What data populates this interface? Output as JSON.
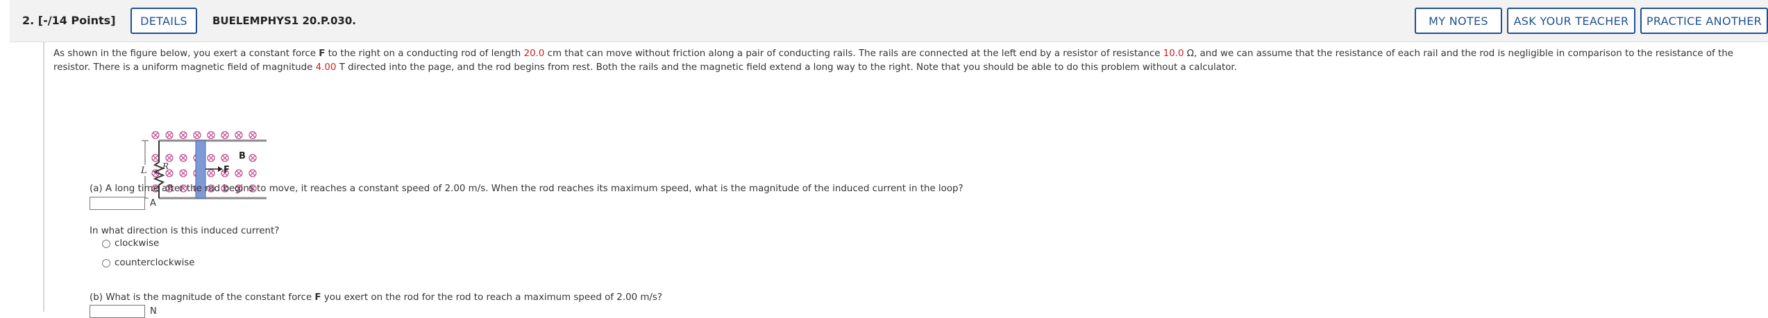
{
  "header": {
    "question_number": "2.",
    "points": "[-/14 Points]",
    "details_label": "DETAILS",
    "problem_code": "BUELEMPHYS1 20.P.030.",
    "my_notes_label": "MY NOTES",
    "ask_teacher_label": "ASK YOUR TEACHER",
    "practice_label": "PRACTICE ANOTHER"
  },
  "intro": {
    "p1": "As shown in the figure below, you exert a constant force ",
    "force_symbol": "F",
    "p2": " to the right on a conducting rod of length ",
    "length_value": "20.0",
    "p3": " cm that can move without friction along a pair of conducting rails. The rails are connected at the left end by a resistor of resistance ",
    "resistance_value": "10.0",
    "p4": " Ω, and we can assume that the resistance of each rail and the rod is negligible in comparison to the resistance of the resistor. There is a uniform magnetic field of magnitude ",
    "field_value": "4.00",
    "p5": " T directed into the page, and the rod begins from rest. Both the rails and the magnetic field extend a long way to the right. Note that you should be able to do this problem without a calculator."
  },
  "figure": {
    "label_L": "L",
    "label_R": "R",
    "label_F": "F",
    "label_B": "B"
  },
  "part_a": {
    "question": "(a) A long time after the rod begins to move, it reaches a constant speed of 2.00 m/s. When the rod reaches its maximum speed, what is the magnitude of the induced current in the loop?",
    "unit": "A",
    "direction_question": "In what direction is this induced current?",
    "options": [
      "clockwise",
      "counterclockwise"
    ]
  },
  "part_b": {
    "question_pre": "(b) What is the magnitude of the constant force ",
    "force_symbol": "F",
    "question_post": " you exert on the rod for the rod to reach a maximum speed of 2.00 m/s?",
    "unit": "N"
  },
  "colors": {
    "accent": "#1f4f8f",
    "given_value": "#d21f1f",
    "field_symbol": "#c0468a",
    "rod": "#7d9ad6"
  }
}
